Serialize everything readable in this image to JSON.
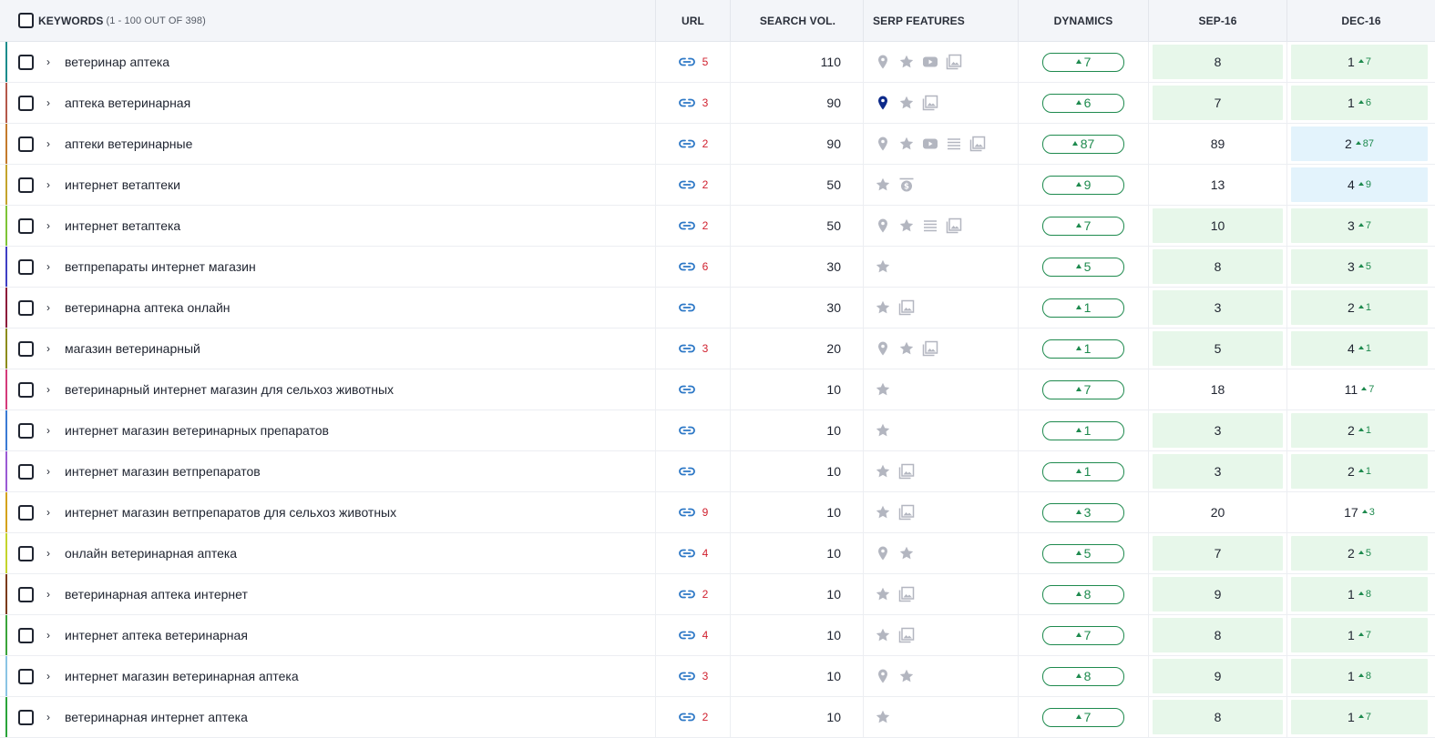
{
  "header": {
    "keywords": "KEYWORDS",
    "keywords_sub": "(1 - 100 OUT OF 398)",
    "url": "URL",
    "search_vol": "SEARCH VOL.",
    "serp_features": "SERP FEATURES",
    "dynamics": "DYNAMICS",
    "sep": "SEP-16",
    "dec": "DEC-16"
  },
  "colors": {
    "positive": "#1e8a4e",
    "url_count": "#d0202e",
    "link": "#2d78c6",
    "highlight_green": "#e7f7ea",
    "highlight_blue": "#e3f3fc"
  },
  "rows": [
    {
      "kw": "ветеринар аптека",
      "urls": "5",
      "vol": "110",
      "serp": [
        "pin",
        "star",
        "video",
        "image"
      ],
      "dyn": "7",
      "sep": "8",
      "dec": "1",
      "dch": "7",
      "stripe": "#1a8c8c",
      "sepbg": "green",
      "decbg": "green"
    },
    {
      "kw": "аптека ветеринарная",
      "urls": "3",
      "vol": "90",
      "serp": [
        "pin-active",
        "star",
        "image"
      ],
      "dyn": "6",
      "sep": "7",
      "dec": "1",
      "dch": "6",
      "stripe": "#b4584a",
      "sepbg": "green",
      "decbg": "green"
    },
    {
      "kw": "аптеки ветеринарные",
      "urls": "2",
      "vol": "90",
      "serp": [
        "pin",
        "star",
        "video",
        "lines",
        "image"
      ],
      "dyn": "87",
      "sep": "89",
      "dec": "2",
      "dch": "87",
      "stripe": "#c47a2c",
      "sepbg": "none",
      "decbg": "blue"
    },
    {
      "kw": "интернет ветаптеки",
      "urls": "2",
      "vol": "50",
      "serp": [
        "star",
        "dollar"
      ],
      "dyn": "9",
      "sep": "13",
      "dec": "4",
      "dch": "9",
      "stripe": "#c4a42c",
      "sepbg": "none",
      "decbg": "blue"
    },
    {
      "kw": "интернет ветаптека",
      "urls": "2",
      "vol": "50",
      "serp": [
        "pin",
        "star",
        "lines",
        "image"
      ],
      "dyn": "7",
      "sep": "10",
      "dec": "3",
      "dch": "7",
      "stripe": "#7ec436",
      "sepbg": "green",
      "decbg": "green"
    },
    {
      "kw": "ветпрепараты интернет магазин",
      "urls": "6",
      "vol": "30",
      "serp": [
        "star"
      ],
      "dyn": "5",
      "sep": "8",
      "dec": "3",
      "dch": "5",
      "stripe": "#3e3ec4",
      "sepbg": "green",
      "decbg": "green"
    },
    {
      "kw": "ветеринарна аптека онлайн",
      "urls": "",
      "vol": "30",
      "serp": [
        "star",
        "image"
      ],
      "dyn": "1",
      "sep": "3",
      "dec": "2",
      "dch": "1",
      "stripe": "#8c1a3a",
      "sepbg": "green",
      "decbg": "green"
    },
    {
      "kw": "магазин ветеринарный",
      "urls": "3",
      "vol": "20",
      "serp": [
        "pin",
        "star",
        "image"
      ],
      "dyn": "1",
      "sep": "5",
      "dec": "4",
      "dch": "1",
      "stripe": "#8c8c1a",
      "sepbg": "green",
      "decbg": "green"
    },
    {
      "kw": "ветеринарный интернет магазин для сельхоз животных",
      "urls": "",
      "vol": "10",
      "serp": [
        "star"
      ],
      "dyn": "7",
      "sep": "18",
      "dec": "11",
      "dch": "7",
      "stripe": "#d43a7a",
      "sepbg": "none",
      "decbg": "none"
    },
    {
      "kw": "интернет магазин ветеринарных препаратов",
      "urls": "",
      "vol": "10",
      "serp": [
        "star"
      ],
      "dyn": "1",
      "sep": "3",
      "dec": "2",
      "dch": "1",
      "stripe": "#3a7ad4",
      "sepbg": "green",
      "decbg": "green"
    },
    {
      "kw": "интернет магазин ветпрепаратов",
      "urls": "",
      "vol": "10",
      "serp": [
        "star",
        "image"
      ],
      "dyn": "1",
      "sep": "3",
      "dec": "2",
      "dch": "1",
      "stripe": "#9a5ad4",
      "sepbg": "green",
      "decbg": "green"
    },
    {
      "kw": "интернет магазин ветпрепаратов для сельхоз животных",
      "urls": "9",
      "vol": "10",
      "serp": [
        "star",
        "image"
      ],
      "dyn": "3",
      "sep": "20",
      "dec": "17",
      "dch": "3",
      "stripe": "#d4a21a",
      "sepbg": "none",
      "decbg": "none"
    },
    {
      "kw": "онлайн ветеринарная аптека",
      "urls": "4",
      "vol": "10",
      "serp": [
        "pin",
        "star"
      ],
      "dyn": "5",
      "sep": "7",
      "dec": "2",
      "dch": "5",
      "stripe": "#c4d42c",
      "sepbg": "green",
      "decbg": "green"
    },
    {
      "kw": "ветеринарная аптека интернет",
      "urls": "2",
      "vol": "10",
      "serp": [
        "star",
        "image"
      ],
      "dyn": "8",
      "sep": "9",
      "dec": "1",
      "dch": "8",
      "stripe": "#7a3a1a",
      "sepbg": "green",
      "decbg": "green"
    },
    {
      "kw": "интернет аптека ветеринарная",
      "urls": "4",
      "vol": "10",
      "serp": [
        "star",
        "image"
      ],
      "dyn": "7",
      "sep": "8",
      "dec": "1",
      "dch": "7",
      "stripe": "#3aa43a",
      "sepbg": "green",
      "decbg": "green"
    },
    {
      "kw": "интернет магазин ветеринарная аптека",
      "urls": "3",
      "vol": "10",
      "serp": [
        "pin",
        "star"
      ],
      "dyn": "8",
      "sep": "9",
      "dec": "1",
      "dch": "8",
      "stripe": "#8ac4e4",
      "sepbg": "green",
      "decbg": "green"
    },
    {
      "kw": "ветеринарная интернет аптека",
      "urls": "2",
      "vol": "10",
      "serp": [
        "star"
      ],
      "dyn": "7",
      "sep": "8",
      "dec": "1",
      "dch": "7",
      "stripe": "#2aa43a",
      "sepbg": "green",
      "decbg": "green"
    }
  ]
}
